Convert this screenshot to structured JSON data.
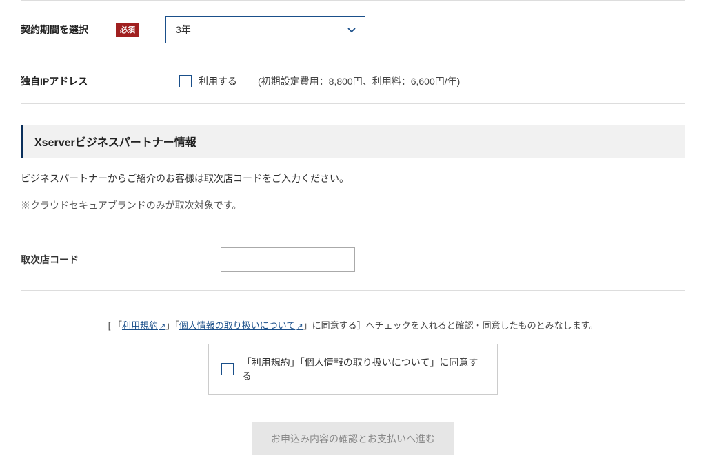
{
  "contract_period": {
    "label": "契約期間を選択",
    "required_badge": "必須",
    "selected": "3年"
  },
  "ip_address": {
    "label": "独自IPアドレス",
    "checkbox_label": "利用する",
    "note": "(初期設定費用：8,800円、利用料：6,600円/年)"
  },
  "partner_section": {
    "heading": "Xserverビジネスパートナー情報",
    "text": "ビジネスパートナーからご紹介のお客様は取次店コードをご入力ください。",
    "note": "※クラウドセキュアブランドのみが取次対象です。",
    "code_label": "取次店コード"
  },
  "terms": {
    "prefix": "[ 「",
    "link1": "利用規約",
    "mid": "」「",
    "link2": "個人情報の取り扱いについて",
    "suffix": "」に同意する］へチェックを入れると確認・同意したものとみなします。",
    "agree_label": "「利用規約」「個人情報の取り扱いについて」に同意する"
  },
  "submit_label": "お申込み内容の確認とお支払いへ進む"
}
